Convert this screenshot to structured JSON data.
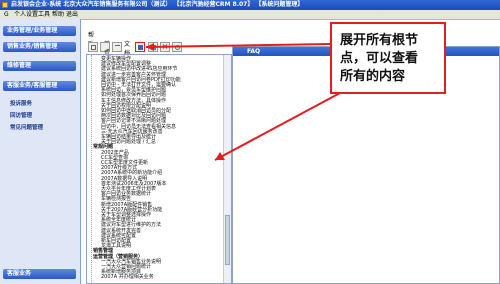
{
  "titlebar": {
    "text": "启发银会企业·系统 北京大众汽车销售服务有限公司（测试） 【北京汽驰经营CRM 8.07】 【系统问题管理】"
  },
  "menubar": {
    "items": [
      "G",
      "个人设置",
      "工具",
      "帮助",
      "退出"
    ]
  },
  "sidebar": {
    "sections": [
      "业务管理/业务管理",
      "销售业务/销售管理",
      "维修管理",
      "客服业务/客服管理"
    ],
    "subitems": [
      "投诉服务",
      "回访管理",
      "常见问题管理"
    ],
    "footer": "客服业务"
  },
  "tabs": [
    "帮助",
    "首页",
    "文档"
  ],
  "right_panel": {
    "header": "FAQ"
  },
  "tree": {
    "rows": [
      "变更车辆操作",
      "建议修改车型配置调整",
      "建议系统回访中改进4S店应用环节",
      "建议进一步完善客户关怀管理",
      "建议新增客户回访问卷PDF打印功能",
      "回访中 - 无法打开文件，需要确认",
      "系统回访，会员车型维护问题",
      "如何处理首次保养后回访问题",
      "车主信息修改方法，具体操作",
      "关于回访权限分配说明",
      "如何回访中途取消回访员的分配",
      "两次回访数据对比及回访问题",
      "客户回访记录不清晰问题处理",
      "回访中，回访员无法查看相关信息",
      "三·无大众汽车回访服务改善",
      "车辆回访结果导出及统计",
      "关于回访问题处理 / 汇总",
      "常规问题",
      "2002年产品",
      "CC车型查询",
      "CC车型年度文件更新",
      "2007A升级方式",
      "2007A系统中的新功能介绍",
      "2007A数据导入说明",
      "首年测试2006年及2007版本",
      "大众平台年度工作计划表",
      "客户回访业务数据统计",
      "车辆检测报告",
      "新增2007A版配件销售",
      "关于2007A版经营分析功能",
      "关于车型调整选择操作",
      "系统全年度统计",
      "建议对车型进行维护的方法",
      "建议系统开发完善",
      "建议系统可配置",
      "新车回访配置",
      "龙潭工具说明",
      "销售管理",
      "运营管理（营销服务）",
      "一汽大众汽车销售业务说明",
      "一汽大众营销问题统计",
      "系统新增服务项目",
      "2007A 并办理相关业务"
    ]
  },
  "callout": {
    "lines": [
      "展开所有根节",
      "点，可以查看",
      "所有的内容"
    ]
  }
}
